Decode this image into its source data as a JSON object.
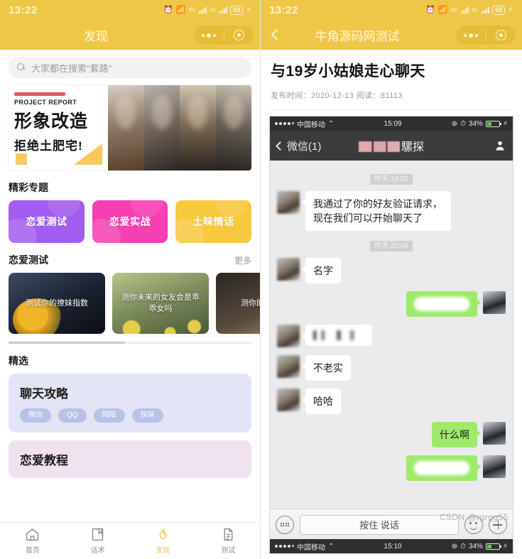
{
  "left": {
    "statusbar": {
      "time": "13:22",
      "battery": "68",
      "network": "4G"
    },
    "navbar": {
      "title": "发现"
    },
    "search": {
      "placeholder": "大家都在搜索\"套路\"",
      "icon": "search-icon"
    },
    "banner": {
      "label": "PROJECT REPORT",
      "title": "形象改造",
      "subtitle": "拒绝土肥宅!"
    },
    "topics_section": {
      "title": "精彩专题"
    },
    "topics": [
      {
        "label": "恋爱测试",
        "color": "#a35df0"
      },
      {
        "label": "恋爱实战",
        "color": "#f63fb3"
      },
      {
        "label": "土味情话",
        "color": "#f7c93f"
      }
    ],
    "tests_section": {
      "title": "恋爱测试",
      "more": "更多"
    },
    "test_cards": [
      {
        "label": "测试你的撩妹指数"
      },
      {
        "label": "测你未来的女友会是乖乖女吗"
      },
      {
        "label": "测你的异性缘"
      }
    ],
    "featured_section": {
      "title": "精选"
    },
    "featured": [
      {
        "title": "聊天攻略",
        "tags": [
          "微信",
          "QQ",
          "陌陌",
          "探探"
        ]
      },
      {
        "title": "恋爱教程",
        "tags": []
      }
    ],
    "tabs": [
      {
        "label": "首页",
        "icon": "home-icon",
        "active": false
      },
      {
        "label": "话术",
        "icon": "book-icon",
        "active": false
      },
      {
        "label": "发现",
        "icon": "flame-icon",
        "active": true
      },
      {
        "label": "测试",
        "icon": "document-icon",
        "active": false
      }
    ]
  },
  "right": {
    "statusbar": {
      "time": "13:22",
      "battery": "68",
      "network": "4G"
    },
    "navbar": {
      "title": "牛角源码网测试",
      "back": "back-chevron-icon"
    },
    "article": {
      "title": "与19岁小姑娘走心聊天",
      "meta": "发布时间：2020-12-13 阅读：81113"
    },
    "wechat": {
      "statusbar": {
        "carrier": "中国移动",
        "time": "15:09",
        "battery": "34%"
      },
      "nav": {
        "back": "微信(1)",
        "name": "騾探",
        "avatar": "person-icon"
      },
      "messages": [
        {
          "type": "timestamp",
          "text": "昨天 18:52"
        },
        {
          "type": "in",
          "text": "我通过了你的好友验证请求，现在我们可以开始聊天了"
        },
        {
          "type": "timestamp",
          "text": "昨天 20:04"
        },
        {
          "type": "in",
          "text": "名字"
        },
        {
          "type": "out",
          "text": "",
          "censored": true
        },
        {
          "type": "in",
          "text": "",
          "blurred": true
        },
        {
          "type": "in",
          "text": "不老实"
        },
        {
          "type": "in",
          "text": "哈哈"
        },
        {
          "type": "out",
          "text": "什么啊"
        },
        {
          "type": "out",
          "text": "",
          "censored": true
        }
      ],
      "input": {
        "keyboard_icon": "keyboard-icon",
        "hold_to_talk": "按住 说话",
        "emoji_icon": "smiley-icon",
        "plus_icon": "plus-icon"
      },
      "next_statusbar": {
        "carrier": "中国移动",
        "time": "15:10",
        "battery": "34%"
      }
    },
    "watermark": "CSDN @rgrgg55"
  }
}
